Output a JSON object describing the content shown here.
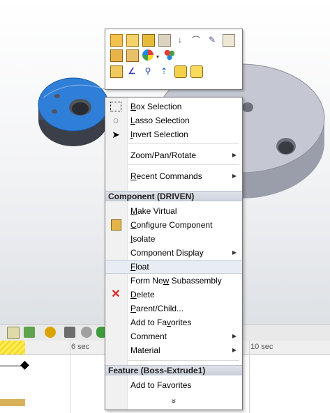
{
  "context_toolbar": {
    "rows": [
      [
        "open-part-icon",
        "assembly-icon",
        "components-icon",
        "assembly-structure-icon",
        "sort-icon",
        "paperclip-icon",
        "edit-sketch-icon",
        "properties-icon"
      ],
      [
        "configure-icon",
        "edit-feature-icon",
        "appearance-icon",
        "color-swatch-icon"
      ],
      [
        "smart-mate-icon",
        "sketch-line-icon",
        "zoom-to-selection-icon",
        "move-triad-icon",
        "hide-icon",
        "show-icon"
      ]
    ]
  },
  "context_menu": {
    "items_top": [
      {
        "label": "Box Selection",
        "underline": "B",
        "rest": "ox Selection",
        "icon": "box-selection-icon"
      },
      {
        "label": "Lasso Selection",
        "underline": "L",
        "rest": "asso Selection",
        "icon": "lasso-selection-icon"
      },
      {
        "label": "Invert Selection",
        "underline": "I",
        "rest": "nvert Selection",
        "icon": "invert-selection-icon"
      }
    ],
    "zoom_pan_rotate": "Zoom/Pan/Rotate",
    "recent_commands": {
      "u": "R",
      "rest": "ecent Commands"
    },
    "component_header": "Component (DRIVEN)",
    "component_items": [
      {
        "u": "M",
        "rest": "ake Virtual"
      },
      {
        "u": "C",
        "rest": "onfigure Component"
      },
      {
        "u": "I",
        "rest": "solate"
      },
      {
        "u": "",
        "rest": "Component Display"
      }
    ],
    "float": {
      "u": "F",
      "rest": "loat"
    },
    "subassembly": {
      "pre": "Form Ne",
      "u": "w",
      "rest": " Subassembly"
    },
    "delete": {
      "u": "D",
      "rest": "elete"
    },
    "parent_child": {
      "u": "P",
      "rest": "arent/Child..."
    },
    "add_favorites": {
      "pre": "Add to Fa",
      "u": "v",
      "rest": "orites"
    },
    "comment": "Comment",
    "material": "Material",
    "feature_header": "Feature (Boss-Extrude1)",
    "feature_add_favorites": "Add to Favorites",
    "expand_glyph": "»"
  },
  "timeline": {
    "labels": [
      "6 sec",
      "10 sec"
    ]
  },
  "colors": {
    "selected_part": "#2f7fd8",
    "gray_part": "#c5c8d2"
  }
}
